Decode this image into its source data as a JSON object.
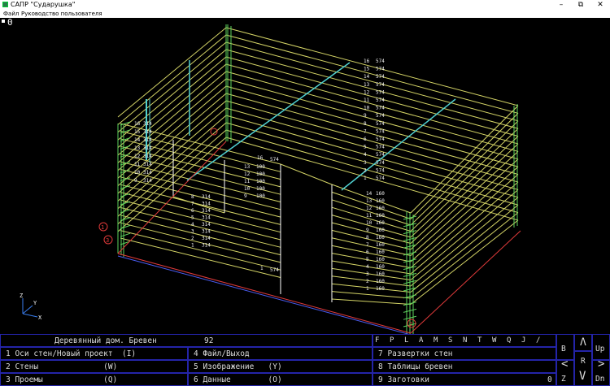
{
  "window": {
    "title": "САПР \"Сударушка\"",
    "controls": {
      "minimize": "–",
      "maximize": "⧉",
      "close": "✕"
    }
  },
  "menu": {
    "items": [
      "Файл",
      "Руководство пользователя"
    ]
  },
  "viewport": {
    "corner_label": "0",
    "axis_labels": {
      "z": "Z",
      "y": "Y",
      "x": "X"
    },
    "node_markers": [
      "1",
      "2",
      "3"
    ],
    "log_numbers": [
      "1",
      "2",
      "3",
      "4",
      "5",
      "6",
      "7",
      "8",
      "9",
      "10",
      "11",
      "12",
      "13",
      "14",
      "15",
      "16"
    ],
    "log_length_back": "574",
    "log_length_front": "160",
    "log_length_opening": "100",
    "log_length_left": "314",
    "colors": {
      "wall_logs": "#d4d466",
      "corner_posts": "#5ed45e",
      "beams": "#4fd0d0",
      "base_red": "#e03a3a",
      "base_blue": "#4a5cf0",
      "markers": "#e03a3a",
      "panel_border": "#2424a8",
      "panel_text": "#dcdcdc"
    }
  },
  "status": {
    "label": "Деревянный дом. Бревен",
    "count": "92"
  },
  "commands": {
    "c1": "1 Оси стен/Новый проект  (I)",
    "c2": "2 Стены              (W)",
    "c3": "3 Проемы             (Q)",
    "c4": "4 Файл/Выход",
    "c5": "5 Изображение   (Y)",
    "c6": "6 Данные        (O)",
    "c7": "7 Развертки стен",
    "c8": "8 Таблицы бревен",
    "c9": "9 Заготовки",
    "c9_value": "0"
  },
  "hotkeys": [
    "F",
    "P",
    "L",
    "A",
    "M",
    "S",
    "N",
    "T",
    "W",
    "Q",
    "J",
    "/"
  ],
  "nav": {
    "B": "B",
    "up_arrow": "Λ",
    "Up": "Up",
    "left_arrow": "<",
    "R": "R",
    "right_arrow": ">",
    "Z": "Z",
    "down_arrow": "V",
    "Dn": "Dn"
  }
}
